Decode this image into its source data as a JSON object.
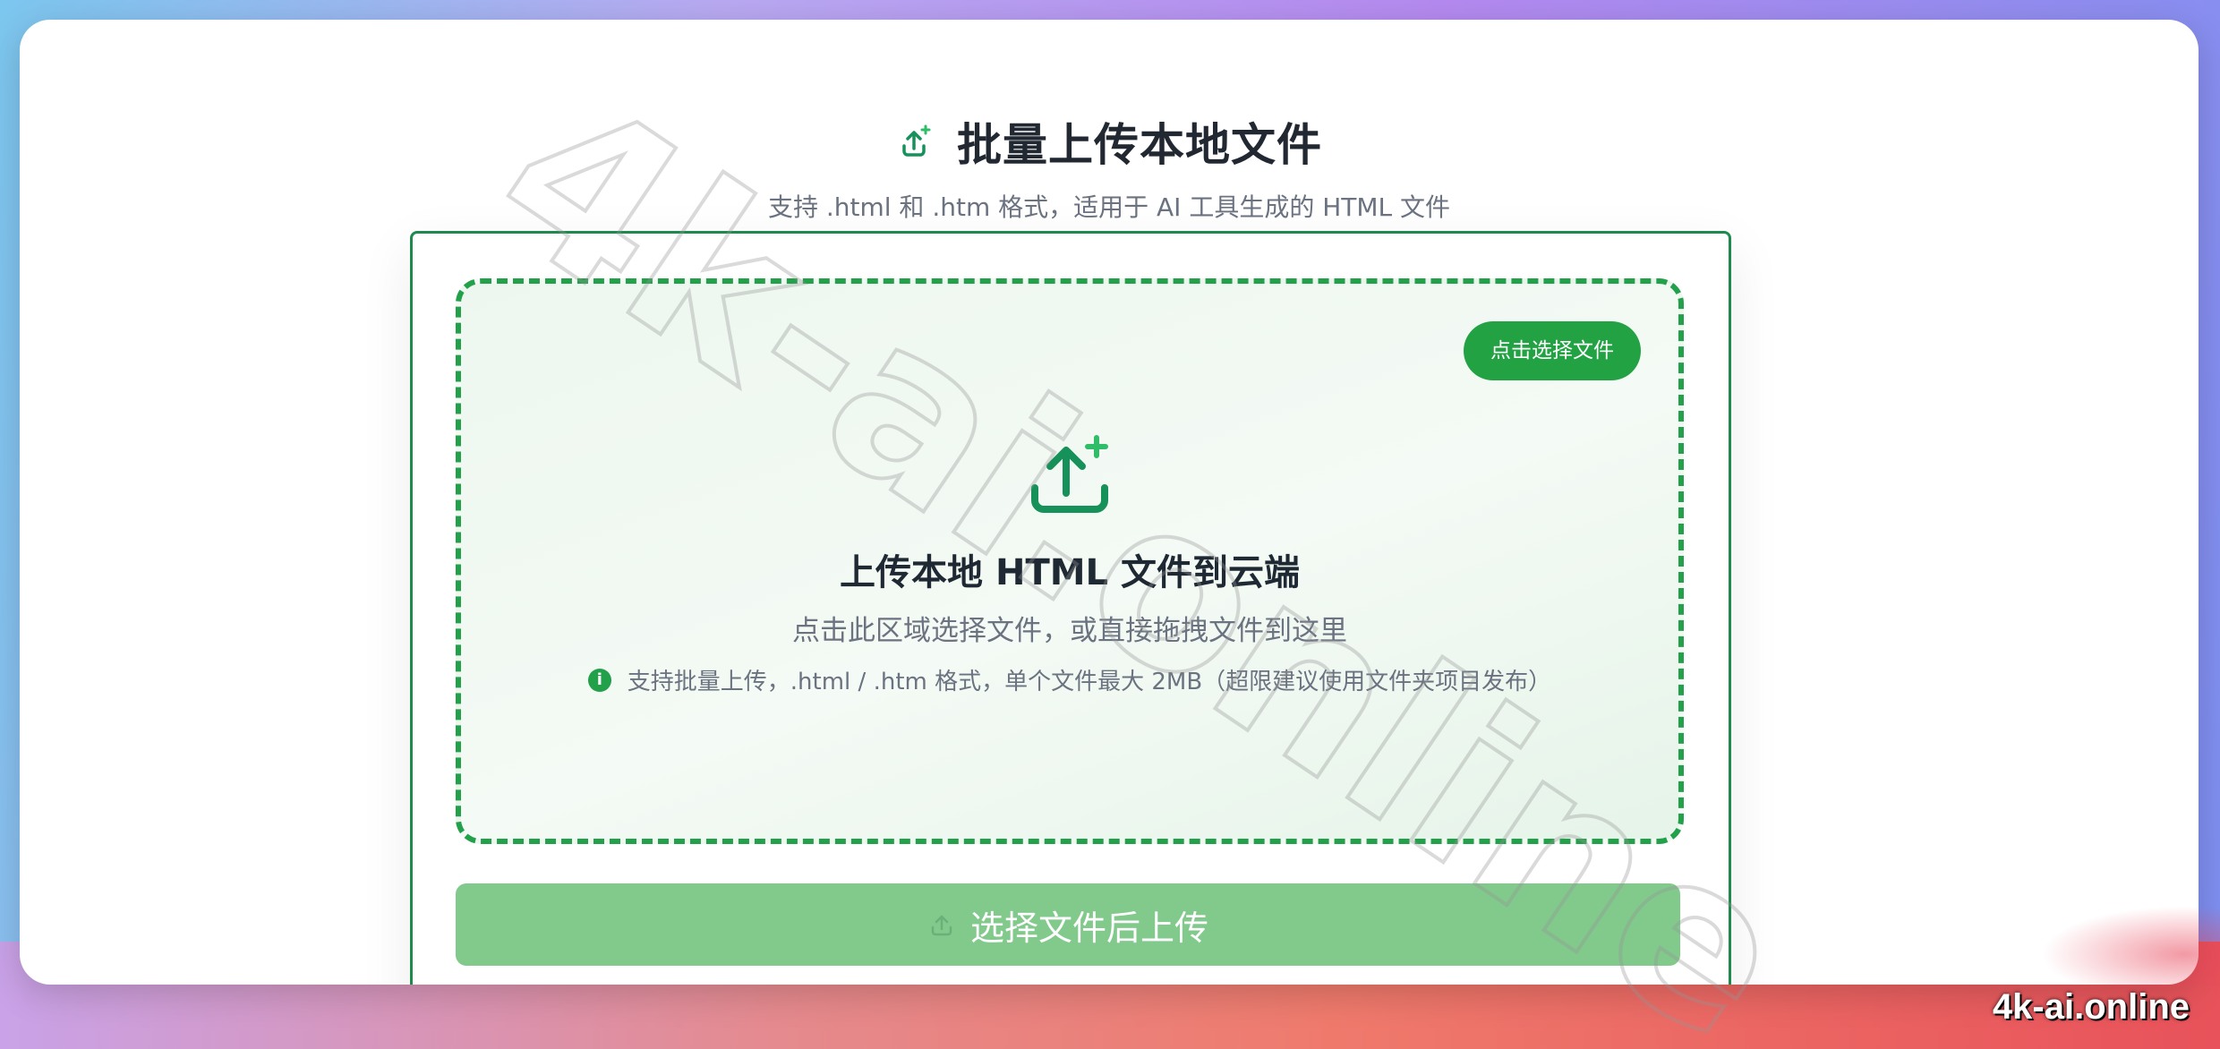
{
  "header": {
    "title": "批量上传本地文件",
    "subtitle": "支持 .html 和 .htm 格式，适用于 AI 工具生成的 HTML 文件"
  },
  "dropzone": {
    "select_button_label": "点击选择文件",
    "heading": "上传本地 HTML 文件到云端",
    "description": "点击此区域选择文件，或直接拖拽文件到这里",
    "note": "支持批量上传，.html / .htm 格式，单个文件最大 2MB（超限建议使用文件夹项目发布）"
  },
  "upload_button": {
    "label": "选择文件后上传",
    "state": "disabled"
  },
  "watermark": {
    "text": "4k-ai.online"
  },
  "brand": {
    "text": "4k-ai.online"
  },
  "colors": {
    "accent": "#23a243",
    "border": "#1e8a4d",
    "icon_dark": "#17915a",
    "icon_light": "#2fbd6a",
    "disabled_button": "#82c98c"
  },
  "icons": {
    "title": "upload-plus-icon",
    "dropzone": "upload-plus-icon",
    "note": "info-icon",
    "button": "upload-icon"
  }
}
